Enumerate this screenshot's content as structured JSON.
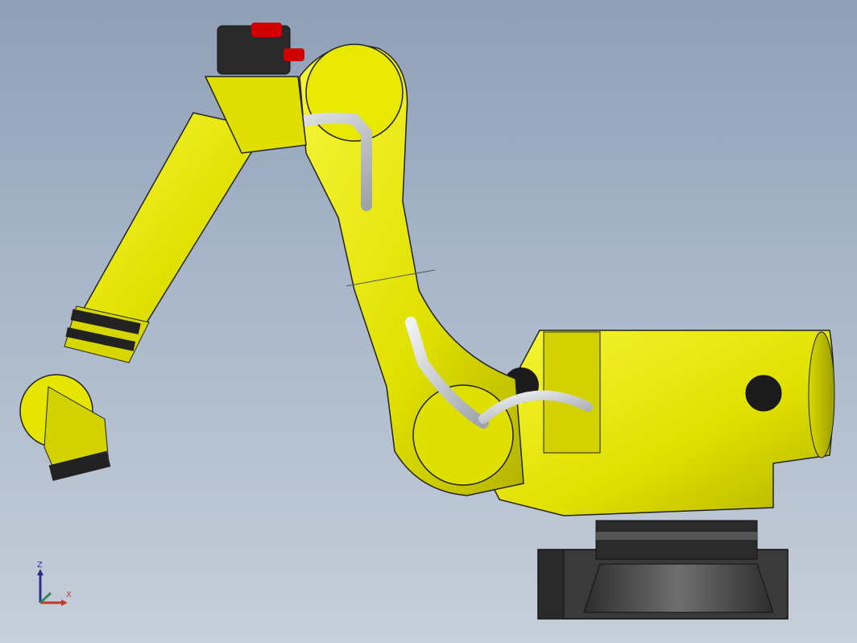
{
  "view": {
    "background_top": "#8f9fb6",
    "background_bottom": "#c6cfda",
    "accent_color": "#e6e600"
  },
  "model": {
    "body_color": "#e6e600",
    "shade_color": "#b8b800",
    "base_color": "#3b3b3b",
    "cable_color": "#c9ccd1",
    "connector_color": "#d10000"
  },
  "triad": {
    "x_label": "X",
    "z_label": "Z",
    "x_color": "#c0392b",
    "y_color": "#2e8b57",
    "z_color": "#2b2f88"
  }
}
